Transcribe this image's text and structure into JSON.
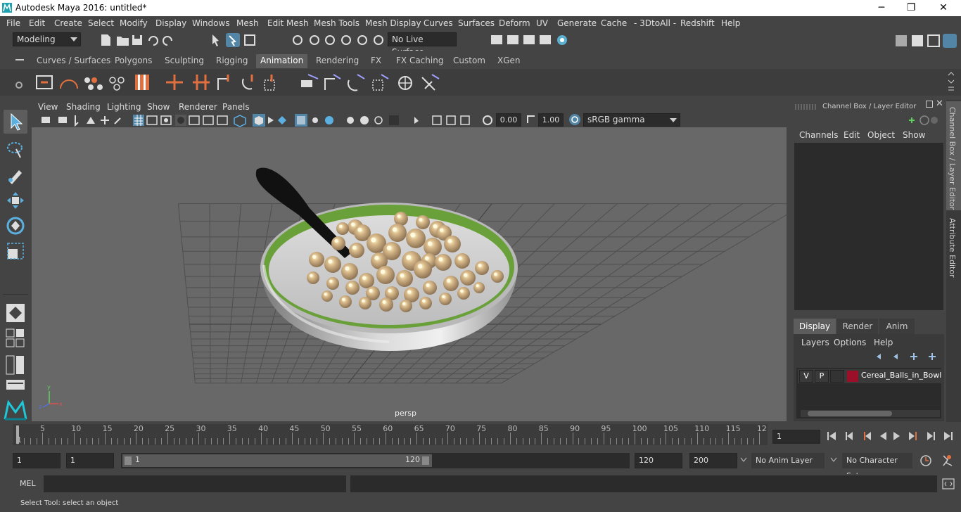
{
  "window": {
    "title": "Autodesk Maya 2016: untitled*",
    "minimize": "─",
    "restore": "❐",
    "close": "✕"
  },
  "menu": [
    "File",
    "Edit",
    "Create",
    "Select",
    "Modify",
    "Display",
    "Windows",
    "Mesh",
    "Edit Mesh",
    "Mesh Tools",
    "Mesh Display",
    "Curves",
    "Surfaces",
    "Deform",
    "UV",
    "Generate",
    "Cache",
    "- 3DtoAll -",
    "Redshift",
    "Help"
  ],
  "statusline": {
    "mode": "Modeling",
    "live_surface": "No Live Surface"
  },
  "shelf": {
    "tabs": [
      "Curves / Surfaces",
      "Polygons",
      "Sculpting",
      "Rigging",
      "Animation",
      "Rendering",
      "FX",
      "FX Caching",
      "Custom",
      "XGen"
    ],
    "active": "Animation"
  },
  "panel": {
    "menus": [
      "View",
      "Shading",
      "Lighting",
      "Show",
      "Renderer",
      "Panels"
    ],
    "exposure": "0.00",
    "gamma": "1.00",
    "color_space": "sRGB gamma",
    "camera_label": "persp"
  },
  "channel_box": {
    "title": "Channel Box / Layer Editor",
    "menus": [
      "Channels",
      "Edit",
      "Object",
      "Show"
    ]
  },
  "layer_editor": {
    "tabs": [
      "Display",
      "Render",
      "Anim"
    ],
    "active": "Display",
    "menus": [
      "Layers",
      "Options",
      "Help"
    ],
    "layer": {
      "v": "V",
      "p": "P",
      "name": "Cereal_Balls_in_Bowl_v",
      "color": "#9b1028"
    }
  },
  "side_tabs": {
    "channel": "Channel Box / Layer Editor",
    "attr": "Attribute Editor"
  },
  "timeline": {
    "ticks": [
      "5",
      "10",
      "15",
      "20",
      "25",
      "30",
      "35",
      "40",
      "45",
      "50",
      "55",
      "60",
      "65",
      "70",
      "75",
      "80",
      "85",
      "90",
      "95",
      "100",
      "105",
      "110",
      "115",
      "12"
    ],
    "start_marker": "1",
    "current_frame": "1"
  },
  "range": {
    "start": "1",
    "anim_start": "1",
    "slider_start": "1",
    "slider_end": "120",
    "end": "120",
    "anim_end": "200",
    "anim_layer": "No Anim Layer",
    "char_set": "No Character Set"
  },
  "command": {
    "label": "MEL"
  },
  "help_line": "Select Tool: select an object",
  "colors": {
    "accent": "#5285a6",
    "bg": "#444444",
    "viewport": "#686868",
    "bowl_rim": "#6aa03a"
  }
}
